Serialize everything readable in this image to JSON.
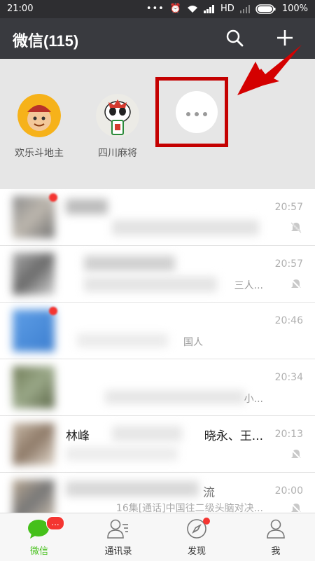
{
  "status": {
    "time": "21:00",
    "network": "HD",
    "battery": "100%"
  },
  "header": {
    "title": "微信(115)"
  },
  "mini_programs": [
    {
      "label": "欢乐斗地主"
    },
    {
      "label": "四川麻将"
    }
  ],
  "chats": [
    {
      "name": "",
      "message": "",
      "time": "20:57",
      "muted": true
    },
    {
      "name": "",
      "message": "三人...",
      "time": "20:57",
      "muted": true
    },
    {
      "name": "",
      "message": "国人",
      "time": "20:46",
      "muted": false
    },
    {
      "name": "",
      "message": "小...",
      "time": "20:34",
      "muted": false
    },
    {
      "name": "林峰",
      "message": "晓永、王...",
      "time": "20:13",
      "muted": true
    },
    {
      "name": "流",
      "message": "16集[通话]中国往二级头脑对决...",
      "time": "20:00",
      "muted": true
    }
  ],
  "tabs": [
    {
      "label": "微信",
      "badge": "..."
    },
    {
      "label": "通讯录"
    },
    {
      "label": "发现"
    },
    {
      "label": "我"
    }
  ],
  "colors": {
    "accent": "#45c01a",
    "badge": "#f43531",
    "annotation": "#c40000"
  }
}
